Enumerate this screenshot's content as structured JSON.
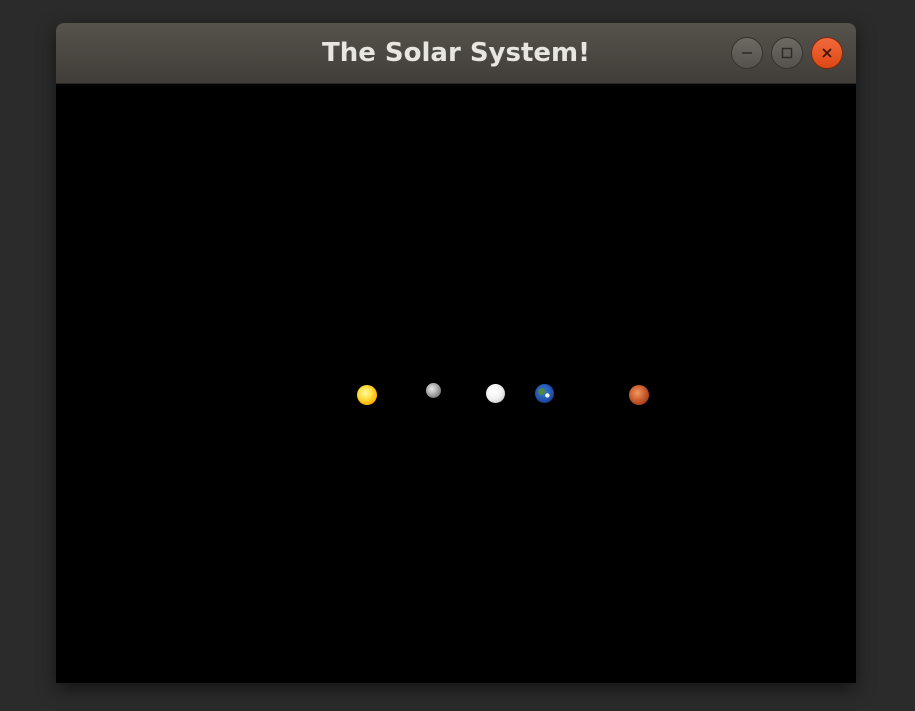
{
  "window": {
    "title": "The Solar System!",
    "controls": {
      "minimize": "minimize-icon",
      "maximize": "maximize-icon",
      "close": "close-icon"
    },
    "colors": {
      "titlebar": "#4a4741",
      "close_button": "#e95420",
      "canvas_background": "#000000"
    }
  },
  "scene": {
    "bodies": [
      {
        "name": "sun",
        "color": "#ffd21f"
      },
      {
        "name": "mercury",
        "color": "#9a9a9a"
      },
      {
        "name": "venus",
        "color": "#f0f0f0"
      },
      {
        "name": "earth",
        "color": "#2f6ac4"
      },
      {
        "name": "mars",
        "color": "#c4572a"
      }
    ]
  }
}
